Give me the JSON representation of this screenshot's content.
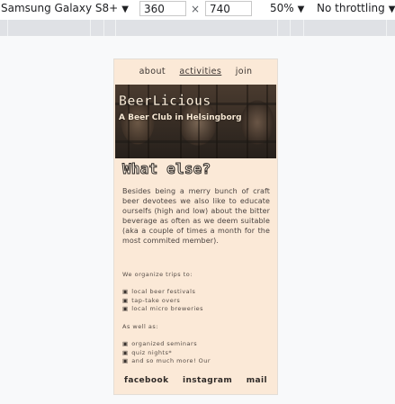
{
  "devtools": {
    "device": "Samsung Galaxy S8+",
    "width": "360",
    "times": "×",
    "height": "740",
    "zoom": "50%",
    "throttling": "No throttling",
    "dropdown_glyph": "▼"
  },
  "site": {
    "nav": [
      "about",
      "activities",
      "join"
    ],
    "hero": {
      "title": "BeerLicious",
      "subtitle": "A Beer Club in Helsingborg"
    },
    "section_title": "What else?",
    "intro": "Besides being a merry bunch of craft beer devotees we also like to educate ourselfs (high and low) about the bitter beverage as often as we deem suitable (aka a couple of times a month for the most commited member).",
    "trips_heading": "We organize trips to:",
    "trips": [
      "local beer festivals",
      "tap-take overs",
      "local micro breweries"
    ],
    "also_heading": "As well as:",
    "also": [
      "organized seminars",
      "quiz nights*",
      "and so much more! Our"
    ],
    "bullet_icon": "beer-mug-icon",
    "bullet_glyph": "▣",
    "footer": [
      "facebook",
      "instagram",
      "mail"
    ]
  }
}
